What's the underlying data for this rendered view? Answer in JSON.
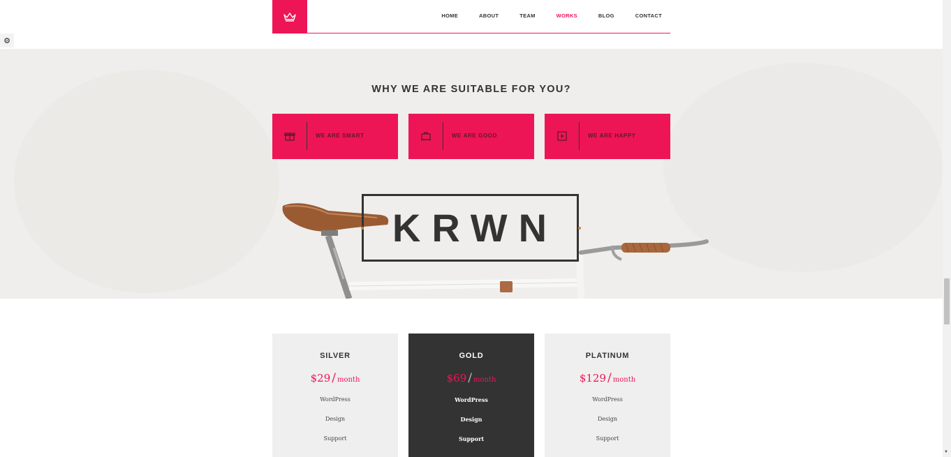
{
  "header": {
    "nav": [
      "HOME",
      "ABOUT",
      "TEAM",
      "WORKS",
      "BLOG",
      "CONTACT"
    ],
    "active_nav": "WORKS"
  },
  "hero": {
    "title": "WHY WE ARE SUITABLE FOR YOU?",
    "features": [
      {
        "label": "WE ARE SMART",
        "icon": "gift-icon"
      },
      {
        "label": "WE ARE GOOD",
        "icon": "briefcase-icon"
      },
      {
        "label": "WE ARE HAPPY",
        "icon": "play-icon"
      }
    ],
    "brand": "KRWN"
  },
  "pricing": {
    "plans": [
      {
        "name": "SILVER",
        "price": "$29",
        "period": "month",
        "features": [
          "WordPress",
          "Design",
          "Support"
        ],
        "highlighted": false
      },
      {
        "name": "GOLD",
        "price": "$69",
        "period": "month",
        "features": [
          "WordPress",
          "Design",
          "Support"
        ],
        "highlighted": true
      },
      {
        "name": "PLATINUM",
        "price": "$129",
        "period": "month",
        "features": [
          "WordPress",
          "Design",
          "Support"
        ],
        "highlighted": false
      }
    ]
  },
  "colors": {
    "accent": "#ee1557",
    "dark": "#333333",
    "card_light": "#efefef"
  },
  "icons": {
    "logo": "crown-icon",
    "settings": "gear-icon"
  }
}
